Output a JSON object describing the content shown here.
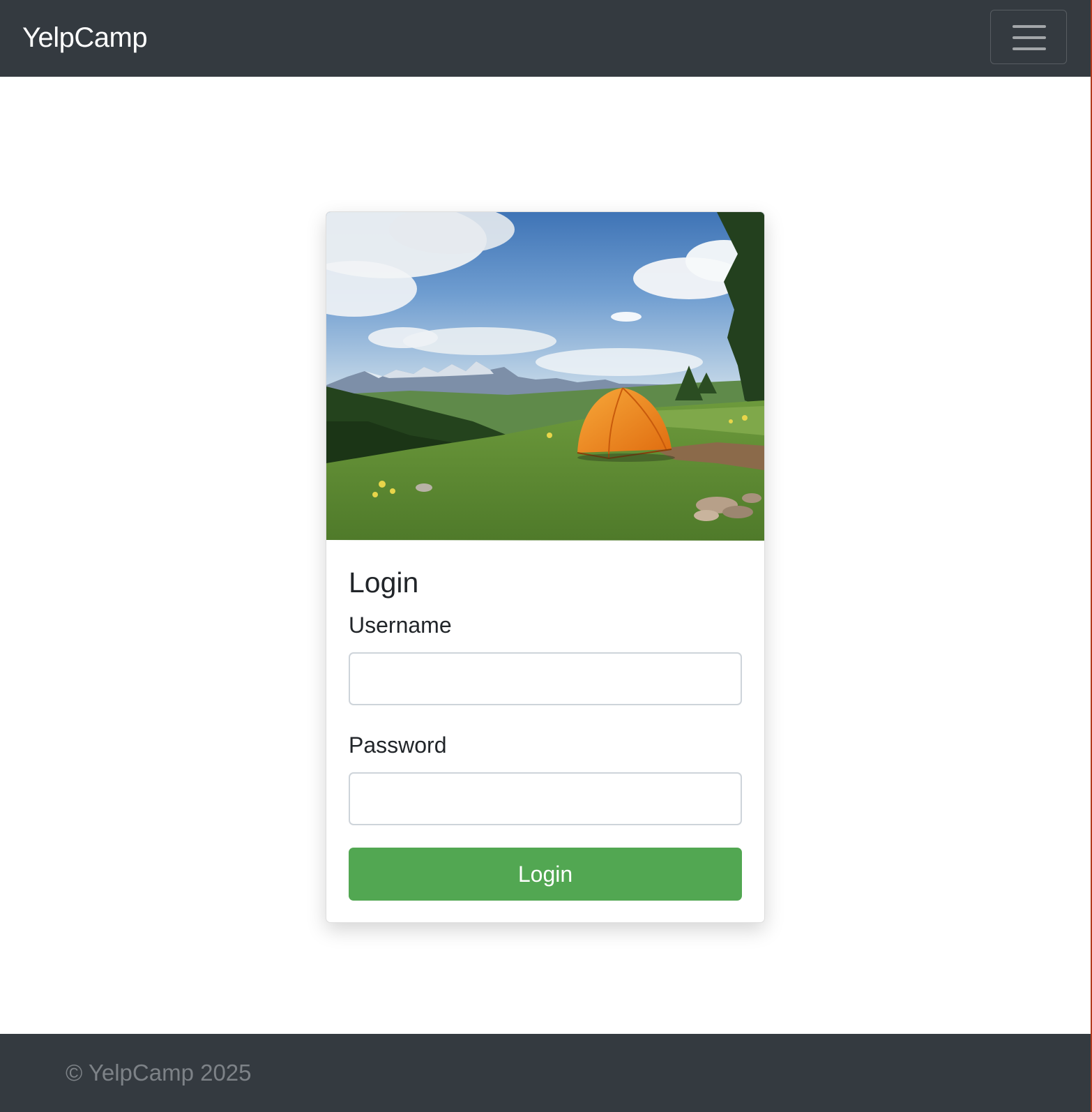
{
  "navbar": {
    "brand": "YelpCamp",
    "toggler_icon": "hamburger-menu-icon"
  },
  "login_card": {
    "image": {
      "subject": "orange tent in a green meadow with mountains and blue sky"
    },
    "title": "Login",
    "username": {
      "label": "Username",
      "value": "",
      "placeholder": ""
    },
    "password": {
      "label": "Password",
      "value": "",
      "placeholder": ""
    },
    "submit_label": "Login"
  },
  "footer": {
    "copyright": "© YelpCamp 2025"
  },
  "colors": {
    "navbar_bg": "#343a40",
    "footer_bg": "#343a40",
    "button_success": "#52a752",
    "footer_text": "#7d8287"
  }
}
